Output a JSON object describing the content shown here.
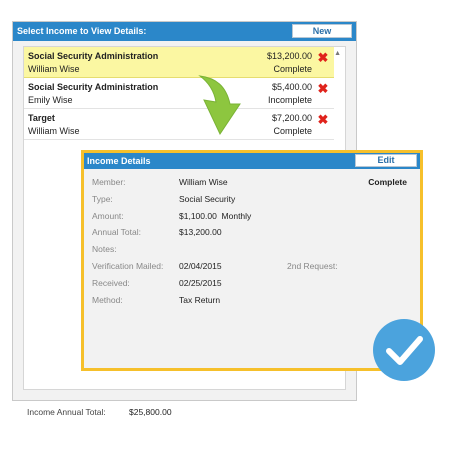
{
  "panel": {
    "title": "Select Income to View Details:",
    "new_label": "New",
    "footer_label": "Income Annual Total:",
    "footer_value": "$25,800.00"
  },
  "incomes": [
    {
      "name": "Social Security Administration",
      "member": "William Wise",
      "amount": "$13,200.00",
      "status": "Complete",
      "selected": true
    },
    {
      "name": "Social Security Administration",
      "member": "Emily Wise",
      "amount": "$5,400.00",
      "status": "Incomplete",
      "selected": false
    },
    {
      "name": "Target",
      "member": "William Wise",
      "amount": "$7,200.00",
      "status": "Complete",
      "selected": false
    }
  ],
  "details": {
    "title": "Income Details",
    "edit_label": "Edit",
    "status": "Complete",
    "labels": {
      "member": "Member:",
      "type": "Type:",
      "amount": "Amount:",
      "annual_total": "Annual Total:",
      "notes": "Notes:",
      "verification_mailed": "Verification Mailed:",
      "received": "Received:",
      "method": "Method:",
      "second_request": "2nd Request:"
    },
    "values": {
      "member": "William Wise",
      "type": "Social Security",
      "amount": "$1,100.00  Monthly",
      "annual_total": "$13,200.00",
      "verification_mailed": "02/04/2015",
      "received": "02/25/2015",
      "method": "Tax Return"
    }
  },
  "icons": {
    "delete": "close-icon",
    "arrow": "arrow-down-icon",
    "check": "checkmark-icon",
    "scroll": "chevron-up-icon"
  },
  "colors": {
    "header_blue": "#2b87c9",
    "selected_row": "#fbf7a2",
    "highlight_border": "#f6c02b",
    "arrow_green": "#8dc63f",
    "delete_red": "#e0231c",
    "check_blue": "#4ba3dd"
  }
}
